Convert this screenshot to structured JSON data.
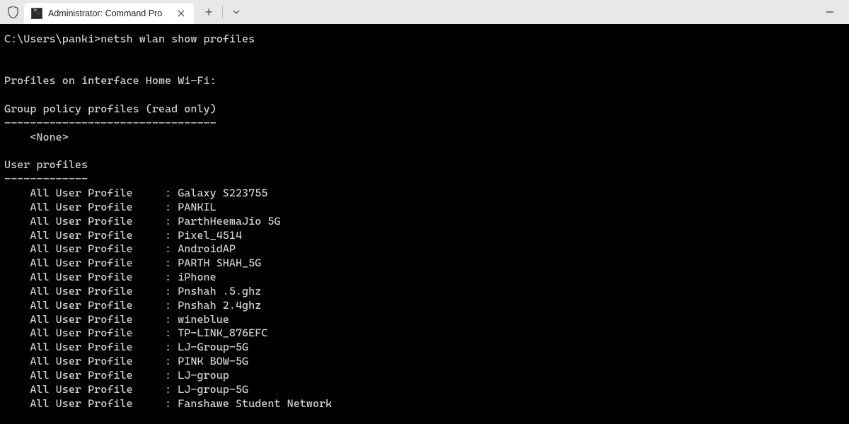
{
  "window": {
    "tab_title": "Administrator: Command Pro",
    "new_tab_label": "+",
    "dropdown_label": "⌄",
    "minimize_label": "—"
  },
  "terminal": {
    "prompt": "C:\\Users\\panki>",
    "command": "netsh wlan show profiles",
    "interface_header": "Profiles on interface Home Wi-Fi:",
    "group_policy_header": "Group policy profiles (read only)",
    "group_policy_divider": "---------------------------------",
    "none_label": "<None>",
    "user_profiles_header": "User profiles",
    "user_profiles_divider": "-------------",
    "profile_label": "All User Profile",
    "profiles": [
      "Galaxy S223755",
      "PANKIL",
      "ParthHeemaJio 5G",
      "Pixel_4514",
      "AndroidAP",
      "PARTH SHAH_5G",
      "iPhone",
      "Pnshah .5.ghz",
      "Pnshah 2.4ghz",
      "wineblue",
      "TP-LINK_876EFC",
      "LJ-Group-5G",
      "PINK BOW-5G",
      "LJ-group",
      "LJ-group-5G",
      "Fanshawe Student Network"
    ]
  }
}
